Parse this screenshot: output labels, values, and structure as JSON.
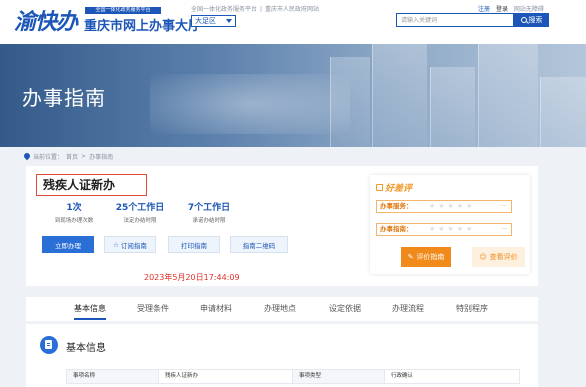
{
  "header": {
    "logo_mark": "渝快办",
    "logo_tag": "全国一体化政务服务平台",
    "logo_name": "重庆市网上办事大厅",
    "platform_link": "全国一体化政务服务平台",
    "gov_link": "重庆市人民政府网站",
    "region": "大足区",
    "register": "注册",
    "login": "登录",
    "accessibility": "网站无障碍",
    "search_placeholder": "请输入关键词",
    "search_label": "搜索"
  },
  "banner": {
    "title": "办事指南"
  },
  "breadcrumb": {
    "prefix": "当前位置：",
    "home": "首页",
    "sep": ">",
    "current": "办事指南"
  },
  "item": {
    "title": "残疾人证新办",
    "stats": [
      {
        "value": "1次",
        "label": "到现场办理次数"
      },
      {
        "value": "25个工作日",
        "label": "法定办结时限"
      },
      {
        "value": "7个工作日",
        "label": "承诺办结时限"
      }
    ],
    "actions": {
      "apply": "立即办理",
      "subscribe": "订阅指南",
      "print": "打印指南",
      "qrcode": "指南二维码"
    },
    "timestamp": "2023年5月20日17:44:09"
  },
  "rating": {
    "logo": "好差评",
    "service_label": "办事服务：",
    "guide_label": "办事指南：",
    "stars": "★★★★★",
    "more": "···",
    "rate_button": "评价指南",
    "view_button": "查看评价"
  },
  "tabs": [
    "基本信息",
    "受理条件",
    "申请材料",
    "办理地点",
    "设定依据",
    "办理流程",
    "特别程序"
  ],
  "basic_info": {
    "title": "基本信息",
    "row": [
      "事项名称",
      "残疾人证新办",
      "事项类型",
      "行政确认"
    ]
  },
  "colors": {
    "brand": "#1c56b8",
    "accent_orange": "#f08a1a",
    "alert_red": "#e0312b"
  }
}
